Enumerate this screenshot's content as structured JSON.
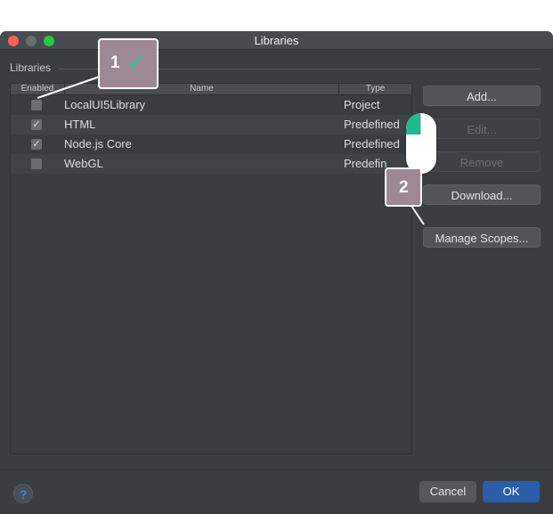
{
  "window": {
    "title": "Libraries"
  },
  "section": {
    "label": "Libraries"
  },
  "table": {
    "columns": {
      "enabled": "Enabled",
      "name": "Name",
      "type": "Type"
    },
    "rows": [
      {
        "checked": false,
        "name": "LocalUI5Library",
        "type": "Project"
      },
      {
        "checked": true,
        "name": "HTML",
        "type": "Predefined"
      },
      {
        "checked": true,
        "name": "Node.js Core",
        "type": "Predefined"
      },
      {
        "checked": false,
        "name": "WebGL",
        "type": "Predefin"
      }
    ]
  },
  "buttons": {
    "add": "Add...",
    "edit": "Edit...",
    "remove": "Remove",
    "download": "Download...",
    "manage_scopes": "Manage Scopes..."
  },
  "footer": {
    "help": "?",
    "cancel": "Cancel",
    "ok": "OK"
  },
  "annotations": {
    "step1": "1",
    "step1_check": "✓",
    "step2": "2"
  },
  "icons": {
    "checkbox_check": "✓"
  },
  "colors": {
    "ok_button": "#2a5eaa",
    "annotation_badge": "#9f8895",
    "annotation_accent": "#1fb98f"
  }
}
